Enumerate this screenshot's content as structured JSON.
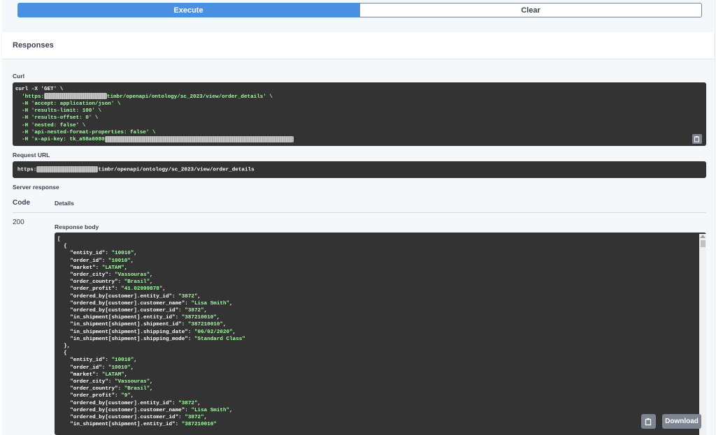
{
  "buttons": {
    "execute": "Execute",
    "clear": "Clear",
    "download": "Download"
  },
  "responses": {
    "title": "Responses",
    "curl_label": "Curl",
    "request_url_label": "Request URL",
    "server_response_label": "Server response",
    "code_header": "Code",
    "details_header": "Details",
    "code": "200",
    "response_body_label": "Response body"
  },
  "curl": {
    "line1": "curl -X 'GET' \\",
    "line2_pre": "  'https:",
    "line2_post": "timbr/openapi/ontology/sc_2023/view/order_details' \\",
    "lines": [
      "  -H 'accept: application/json' \\",
      "  -H 'results-limit: 100' \\",
      "  -H 'results-offset: 0' \\",
      "  -H 'nested: false' \\",
      "  -H 'api-nested-format-properties: false' \\"
    ],
    "last_pre": "  -H 'x-api-key: tk_a58a6080"
  },
  "request_url": {
    "pre": "https:",
    "post": "timbr/openapi/ontology/sc_2023/view/order_details"
  },
  "response_body": {
    "open": "[",
    "records": [
      {
        "fields": [
          {
            "k": "entity_id",
            "v": "10010"
          },
          {
            "k": "order_id",
            "v": "10010"
          },
          {
            "k": "market",
            "v": "LATAM"
          },
          {
            "k": "order_city",
            "v": "Vassouras"
          },
          {
            "k": "order_country",
            "v": "Brasil"
          },
          {
            "k": "order_profit",
            "v": "41.02999878"
          },
          {
            "k": "ordered_by[customer].entity_id",
            "v": "3872"
          },
          {
            "k": "ordered_by[customer].customer_name",
            "v": "Lisa Smith"
          },
          {
            "k": "ordered_by[customer].customer_id",
            "v": "3872"
          },
          {
            "k": "in_shipment[shipment].entity_id",
            "v": "387210010"
          },
          {
            "k": "in_shipment[shipment].shipment_id",
            "v": "387210010"
          },
          {
            "k": "in_shipment[shipment].shipping_date",
            "v": "06/02/2020"
          },
          {
            "k": "in_shipment[shipment].shipping_mode",
            "v": "Standard Class"
          }
        ]
      },
      {
        "fields": [
          {
            "k": "entity_id",
            "v": "10010"
          },
          {
            "k": "order_id",
            "v": "10010"
          },
          {
            "k": "market",
            "v": "LATAM"
          },
          {
            "k": "order_city",
            "v": "Vassouras"
          },
          {
            "k": "order_country",
            "v": "Brasil"
          },
          {
            "k": "order_profit",
            "v": "9"
          },
          {
            "k": "ordered_by[customer].entity_id",
            "v": "3872"
          },
          {
            "k": "ordered_by[customer].customer_name",
            "v": "Lisa Smith"
          },
          {
            "k": "ordered_by[customer].customer_id",
            "v": "3872"
          },
          {
            "k": "in_shipment[shipment].entity_id",
            "v": "387210010"
          }
        ]
      }
    ]
  },
  "colors": {
    "accent": "#4990e2",
    "code_bg": "#333333",
    "string": "#a2fca2"
  }
}
